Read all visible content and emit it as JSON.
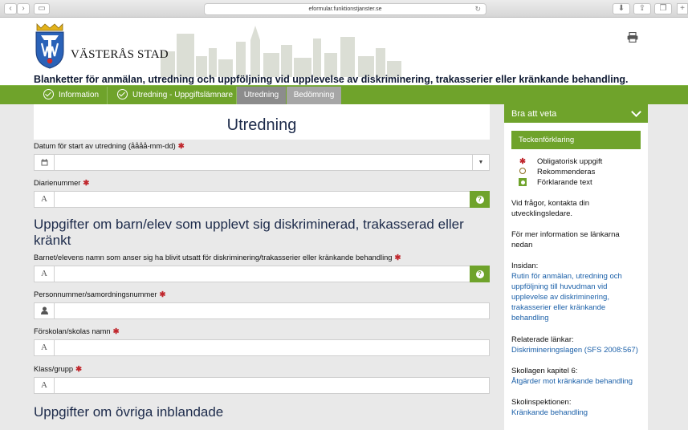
{
  "browser": {
    "url": "eformular.funktionstjanster.se"
  },
  "header": {
    "brand": "VÄSTERÅS STAD",
    "subtitle": "Blanketter för anmälan, utredning och uppföljning vid upplevelse av diskriminering, trakasserier eller kränkande behandling."
  },
  "nav": {
    "tabs": [
      {
        "label": "Information",
        "state": "done"
      },
      {
        "label": "Utredning - Uppgiftslämnare",
        "state": "done"
      },
      {
        "label": "Utredning",
        "state": "active"
      },
      {
        "label": "Bedömning",
        "state": "upcoming"
      }
    ]
  },
  "form": {
    "title": "Utredning",
    "fields": [
      {
        "label": "Datum för start av utredning (åååå-mm-dd)",
        "value": "",
        "icon": "calendar-icon"
      },
      {
        "label": "Diarienummer",
        "value": "",
        "icon": "text-icon"
      },
      {
        "label": "Barnet/elevens namn som anser sig ha blivit utsatt för diskriminering/trakasserier eller kränkande behandling",
        "value": "",
        "icon": "text-icon"
      },
      {
        "label": "Personnummer/samordningsnummer",
        "value": "",
        "icon": "person-icon"
      },
      {
        "label": "Förskolan/skolas namn",
        "value": "",
        "icon": "text-icon"
      },
      {
        "label": "Klass/grupp",
        "value": "",
        "icon": "text-icon"
      }
    ],
    "section1": "Uppgifter om barn/elev som upplevt sig diskriminerad, trakasserad eller kränkt",
    "section2": "Uppgifter om övriga inblandade",
    "required_mark": "✱",
    "text_icon_glyph": "A"
  },
  "sidebar": {
    "heading": "Bra att veta",
    "legend_title": "Teckenförklaring",
    "legend": {
      "required": "Obligatorisk uppgift",
      "recommended": "Rekommenderas",
      "explanatory": "Förklarande text"
    },
    "contact": "Vid frågor, kontakta din utvecklingsledare.",
    "more_info": "För mer information se länkarna nedan",
    "insidan_label": "Insidan:",
    "insidan_link": "Rutin för anmälan, utredning och uppföljning till huvudman vid upplevelse av diskriminering, trakasserier eller kränkande behandling",
    "related_label": "Relaterade länkar:",
    "related_link": "Diskrimineringslagen (SFS 2008:567)",
    "skollagen_label": "Skollagen kapitel 6:",
    "skollagen_link": "Åtgärder mot kränkande behandling",
    "skolinsp_label": "Skolinspektionen:",
    "skolinsp_link": "Kränkande behandling"
  },
  "colors": {
    "accent_green": "#6fa32b",
    "heading_navy": "#1c2a4a",
    "link_blue": "#1a5fa8",
    "required_red": "#c0272d"
  }
}
